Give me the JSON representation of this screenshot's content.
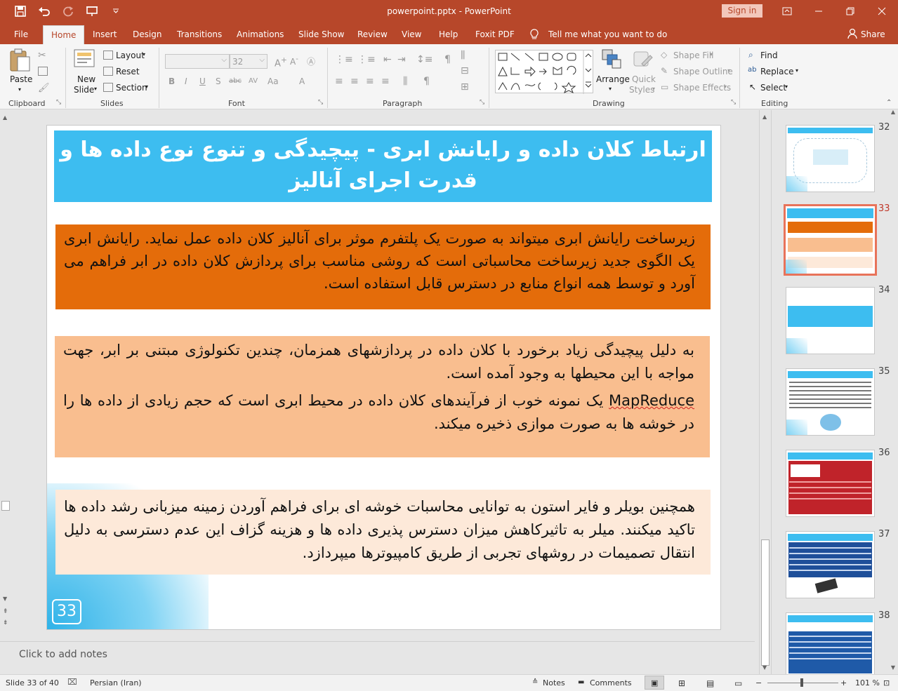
{
  "window": {
    "doc_title": "powerpoint.pptx - PowerPoint",
    "sign_in": "Sign in"
  },
  "tabs": [
    "File",
    "Home",
    "Insert",
    "Design",
    "Transitions",
    "Animations",
    "Slide Show",
    "Review",
    "View",
    "Help",
    "Foxit PDF"
  ],
  "tell_me": "Tell me what you want to do",
  "share": "Share",
  "ribbon": {
    "clipboard": {
      "paste": "Paste",
      "label": "Clipboard"
    },
    "slides": {
      "new_slide_1": "New",
      "new_slide_2": "Slide",
      "layout": "Layout",
      "reset": "Reset",
      "section": "Section",
      "label": "Slides"
    },
    "font": {
      "font_name": "",
      "font_size": "32",
      "label": "Font"
    },
    "paragraph": {
      "label": "Paragraph"
    },
    "drawing": {
      "arrange": "Arrange",
      "quick_styles_1": "Quick",
      "quick_styles_2": "Styles",
      "shape_fill": "Shape Fill",
      "shape_outline": "Shape Outline",
      "shape_effects": "Shape Effects",
      "label": "Drawing"
    },
    "editing": {
      "find": "Find",
      "replace": "Replace",
      "select": "Select",
      "label": "Editing"
    }
  },
  "slide": {
    "title": "ارتباط کلان داده و رایانش ابری - پیچیدگی و تنوع نوع داده ها و قدرت اجرای آنالیز",
    "box1": "زیرساخت رایانش ابری میتواند به صورت یک پلتفرم موثر برای آنالیز کلان داده عمل نماید. رایانش ابری یک الگوی جدید زیرساخت محاسباتی است که روشی مناسب برای پردازش کلان داده در ابر فراهم می آورد و توسط همه انواع منابع در دسترس قابل استفاده است.",
    "box2_p1": "به دلیل پیچیدگی زیاد برخورد با کلان داده در پردازشهای همزمان، چندین تکنولوژی مبتنی بر ابر، جهت مواجه با این محیطها به وجود آمده است.",
    "box2_mapreduce": "MapReduce",
    "box2_p2": " یک نمونه خوب از فرآیندهای کلان داده در محیط ابری است که حجم زیادی از داده ها را در خوشه ها به صورت موازی ذخیره میکند.",
    "box3": "همچنین بویلر و فایر استون به توانایی محاسبات خوشه ای برای فراهم آوردن زمینه میزبانی رشد داده ها تاکید میکنند. میلر به تاثیرکاهش میزان دسترس پذیری داده ها و هزینه گزاف این عدم دسترسی به دلیل انتقال تصمیمات در روشهای تجربی از طریق کامپیوترها میپردازد.",
    "number": "33"
  },
  "notes_placeholder": "Click to add notes",
  "thumbnails": [
    "32",
    "33",
    "34",
    "35",
    "36",
    "37",
    "38"
  ],
  "selected_thumbnail": "33",
  "status": {
    "slide_info": "Slide 33 of 40",
    "language": "Persian (Iran)",
    "notes": "Notes",
    "comments": "Comments",
    "zoom": "101 %"
  },
  "colors": {
    "accent": "#b7472a",
    "title_fill": "#3dbdf0",
    "box1_fill": "#e46c0a",
    "box2_fill": "#f9be8f",
    "box3_fill": "#fde9d9"
  }
}
